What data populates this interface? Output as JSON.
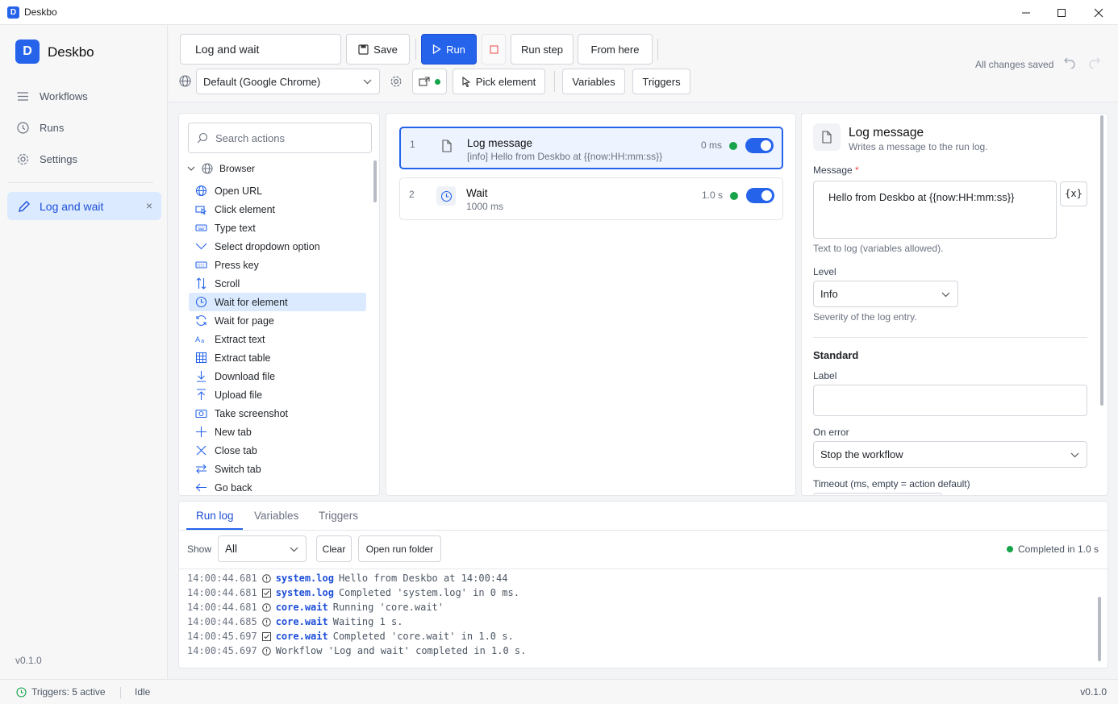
{
  "window": {
    "title": "Deskbo",
    "app_icon_letter": "D"
  },
  "sidebar": {
    "brand": "Deskbo",
    "brand_letter": "D",
    "items": [
      {
        "label": "Workflows",
        "icon": "list-icon"
      },
      {
        "label": "Runs",
        "icon": "history-icon"
      },
      {
        "label": "Settings",
        "icon": "gear-icon"
      }
    ],
    "open_tab": {
      "label": "Log and wait",
      "close": "×"
    },
    "version": "v0.1.0"
  },
  "toolbar": {
    "workflow_name": "Log and wait",
    "save_label": "Save",
    "run_label": "Run",
    "run_step_label": "Run step",
    "from_here_label": "From here",
    "browser_select": "Default (Google Chrome)",
    "pick_element_label": "Pick element",
    "variables_label": "Variables",
    "triggers_label": "Triggers",
    "status": "All changes saved"
  },
  "actions": {
    "search_placeholder": "Search actions",
    "group": "Browser",
    "items": [
      {
        "label": "Open URL",
        "icon": "globe-icon"
      },
      {
        "label": "Click element",
        "icon": "click-icon"
      },
      {
        "label": "Type text",
        "icon": "keyboard-icon"
      },
      {
        "label": "Select dropdown option",
        "icon": "chevron-down-icon"
      },
      {
        "label": "Press key",
        "icon": "keyboard-icon"
      },
      {
        "label": "Scroll",
        "icon": "scroll-icon"
      },
      {
        "label": "Wait for element",
        "icon": "clock-icon",
        "selected": true
      },
      {
        "label": "Wait for page",
        "icon": "refresh-icon"
      },
      {
        "label": "Extract text",
        "icon": "text-icon"
      },
      {
        "label": "Extract table",
        "icon": "table-icon"
      },
      {
        "label": "Download file",
        "icon": "download-icon"
      },
      {
        "label": "Upload file",
        "icon": "upload-icon"
      },
      {
        "label": "Take screenshot",
        "icon": "camera-icon"
      },
      {
        "label": "New tab",
        "icon": "plus-icon"
      },
      {
        "label": "Close tab",
        "icon": "close-icon"
      },
      {
        "label": "Switch tab",
        "icon": "switch-icon"
      },
      {
        "label": "Go back",
        "icon": "arrow-left-icon"
      }
    ]
  },
  "steps": [
    {
      "num": "1",
      "title": "Log message",
      "sub": "[info] Hello from Deskbo at {{now:HH:mm:ss}}",
      "time": "0 ms",
      "enabled": true,
      "active": true
    },
    {
      "num": "2",
      "title": "Wait",
      "sub": "1000 ms",
      "time": "1.0 s",
      "enabled": true,
      "active": false
    }
  ],
  "properties": {
    "title": "Log message",
    "subtitle": "Writes a message to the run log.",
    "message_label": "Message",
    "required_mark": "*",
    "message_value": "Hello from Deskbo at {{now:HH:mm:ss}}",
    "var_button": "{x}",
    "message_hint": "Text to log (variables allowed).",
    "level_label": "Level",
    "level_value": "Info",
    "level_hint": "Severity of the log entry.",
    "standard_heading": "Standard",
    "label_label": "Label",
    "label_value": "",
    "on_error_label": "On error",
    "on_error_value": "Stop the workflow",
    "timeout_label": "Timeout (ms, empty = action default)"
  },
  "log_panel": {
    "tabs": [
      "Run log",
      "Variables",
      "Triggers"
    ],
    "show_label": "Show",
    "filter_value": "All",
    "clear_label": "Clear",
    "open_folder_label": "Open run folder",
    "status": "Completed in 1.0 s",
    "lines": [
      {
        "ts": "14:00:44.681",
        "icon": "info-icon",
        "src": "system.log",
        "msg": "Hello from Deskbo at 14:00:44"
      },
      {
        "ts": "14:00:44.681",
        "icon": "check-icon",
        "src": "system.log",
        "msg": "Completed 'system.log' in 0 ms."
      },
      {
        "ts": "14:00:44.681",
        "icon": "info-icon",
        "src": "core.wait",
        "msg": "Running 'core.wait'"
      },
      {
        "ts": "14:00:44.685",
        "icon": "info-icon",
        "src": "core.wait",
        "msg": "Waiting 1 s."
      },
      {
        "ts": "14:00:45.697",
        "icon": "check-icon",
        "src": "core.wait",
        "msg": "Completed 'core.wait' in 1.0 s."
      },
      {
        "ts": "14:00:45.697",
        "icon": "info-icon",
        "src": "",
        "msg": "Workflow 'Log and wait' completed in 1.0 s."
      }
    ]
  },
  "statusbar": {
    "triggers": "Triggers: 5 active",
    "state": "Idle",
    "version": "v0.1.0"
  },
  "colors": {
    "accent": "#2563eb",
    "success": "#16a34a",
    "danger": "#ef4444"
  }
}
